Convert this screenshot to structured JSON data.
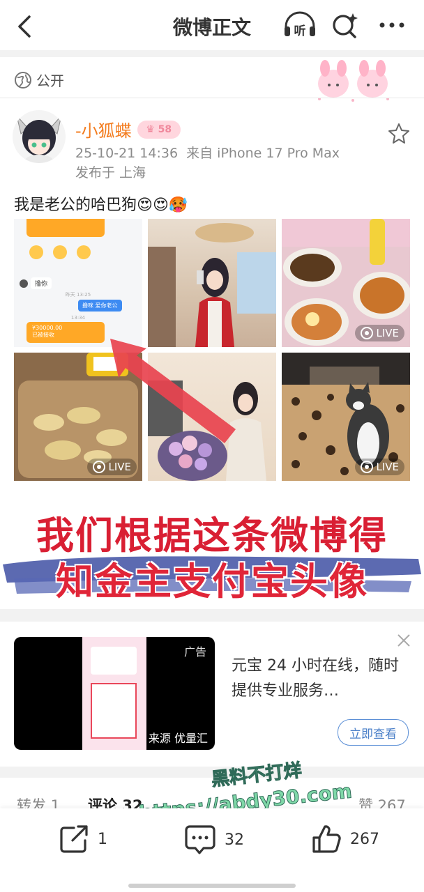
{
  "header": {
    "title": "微博正文",
    "listen_label": "听"
  },
  "post": {
    "visibility": "公开",
    "author_name": "-小狐蝶",
    "badge": "58",
    "time": "25-10-21 14:36",
    "source": "来自 iPhone 17 Pro Max",
    "location": "发布于 上海",
    "text": "我是老公的哈巴狗",
    "emojis": "😍😍🥵",
    "live_label": "LIVE",
    "chat_snippets": {
      "msg1": "撸你",
      "time1": "昨天 13:25",
      "msg2": "撸咪 爱你老公",
      "time2": "13:34",
      "transfer_amount": "¥30000.00",
      "transfer_note": "已被接收"
    }
  },
  "overlay": {
    "line1": "我们根据这条微博得",
    "line2": "知金主支付宝头像"
  },
  "ad": {
    "tag": "广告",
    "source": "来源 优量汇",
    "text": "元宝 24 小时在线，随时提供专业服务…",
    "button": "立即查看"
  },
  "tabs": {
    "reposts": "转发 1",
    "comments": "评论 32",
    "likes": "赞 267"
  },
  "watermark": {
    "line1": "黑料不打烊",
    "line2": "https://abdy30.com"
  },
  "actions": {
    "repost_count": "1",
    "comment_count": "32",
    "like_count": "267"
  },
  "colors": {
    "author": "#f37b1d",
    "overlay_text": "#d91f33",
    "button_blue": "#4a7fc8",
    "watermark": "#7fd8a8"
  }
}
